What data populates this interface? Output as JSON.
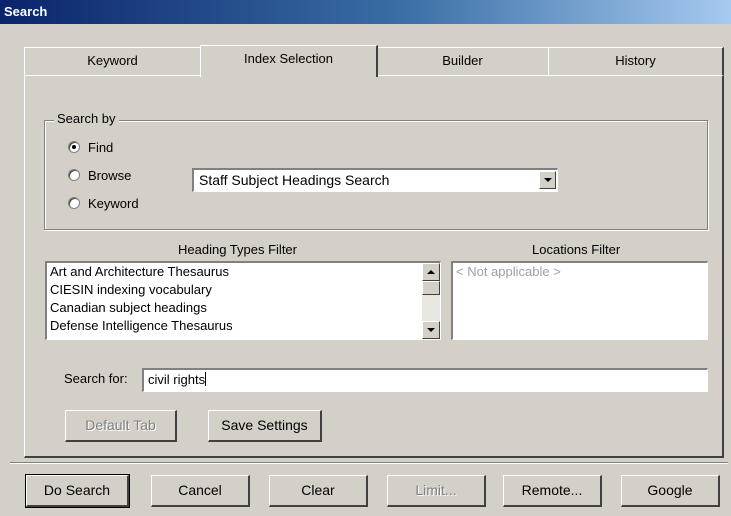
{
  "window": {
    "title": "Search"
  },
  "tabs": [
    {
      "label": "Keyword",
      "active": false
    },
    {
      "label": "Index Selection",
      "active": true
    },
    {
      "label": "Builder",
      "active": false
    },
    {
      "label": "History",
      "active": false
    }
  ],
  "search_by": {
    "legend": "Search by",
    "options": [
      {
        "label": "Find",
        "checked": true
      },
      {
        "label": "Browse",
        "checked": false
      },
      {
        "label": "Keyword",
        "checked": false
      }
    ],
    "index_select": {
      "value": "Staff Subject Headings Search"
    }
  },
  "heading_types_filter": {
    "label": "Heading Types Filter",
    "items": [
      "Art and Architecture Thesaurus",
      "CIESIN indexing vocabulary",
      "Canadian subject headings",
      "Defense Intelligence Thesaurus"
    ]
  },
  "locations_filter": {
    "label": "Locations Filter",
    "placeholder": "< Not applicable >"
  },
  "search_for": {
    "label": "Search for:",
    "value": "civil rights"
  },
  "settings_buttons": {
    "default_tab": "Default Tab",
    "save_settings": "Save Settings"
  },
  "footer_buttons": {
    "do_search": "Do Search",
    "cancel": "Cancel",
    "clear": "Clear",
    "limit": "Limit...",
    "remote": "Remote...",
    "google": "Google"
  },
  "colors": {
    "title_gradient_start": "#0a246a",
    "title_gradient_end": "#a6caf0",
    "face": "#d4d0c8"
  }
}
